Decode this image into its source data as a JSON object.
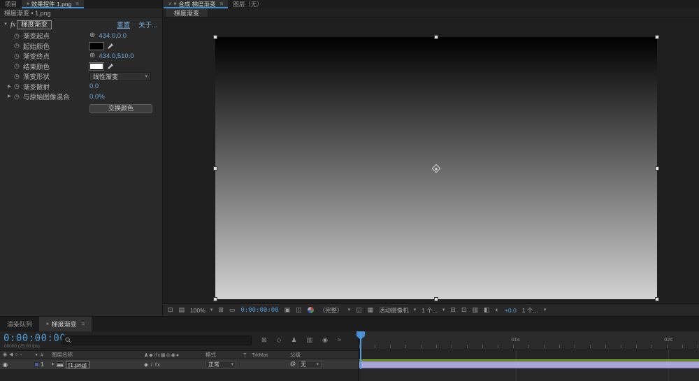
{
  "colors": {
    "accent": "#3f8fd2",
    "value_blue": "#6fa8d8",
    "timecode_blue": "#4d9bd6",
    "green_bar": "#74ab10",
    "layer_bar": "#a8a5d6",
    "label_chip": "#4f5d99",
    "canvas_top": "#000000",
    "canvas_bottom": "#d2d2d2"
  },
  "icons": {
    "panel": "■",
    "menu": "≡",
    "close": "×",
    "tri_down": "▼",
    "tri_right": "▶",
    "stopwatch": "◷",
    "crosshair": "⊕",
    "chevron": "▾",
    "screen": "⊡",
    "monitor": "▤",
    "grid_options": "⊞",
    "mask_vis": "▭",
    "snapshot": "▣",
    "show_snapshot": "◫",
    "roi": "◱",
    "transparency_grid": "▦",
    "pixel_aspect": "⊟",
    "fast_previews": "⊡",
    "ruler": "▥",
    "guides": "◧",
    "exposure": "◐",
    "flowchart": "⊠",
    "draft3d": "◇",
    "shy": "♟",
    "frame_blend": "▥",
    "motion_blur": "◉",
    "graph_editor": "≈",
    "eye": "◉",
    "audio": "◀",
    "solo": "○",
    "lock": "▫",
    "label_dot": "●",
    "hash": "#",
    "switches_header": "♟◆\\fx▦◎◉●",
    "layer_switches": "◆ / fx",
    "pickwhip": "@"
  },
  "left_panel": {
    "tabs": [
      {
        "label": "项目"
      },
      {
        "label": "效果控件 1.png"
      }
    ],
    "breadcrumb": "梯度渐变 • 1.png",
    "effect": {
      "fx": "fx",
      "name": "梯度渐变",
      "reset": "重置",
      "about": "关于...",
      "rows": [
        {
          "label": "渐变起点",
          "value": "434.0,0.0"
        },
        {
          "label": "起始颜色",
          "color": "#000000"
        },
        {
          "label": "渐变终点",
          "value": "434.0,510.0"
        },
        {
          "label": "结束颜色",
          "color": "#ffffff"
        },
        {
          "label": "渐变形状",
          "value": "线性渐变"
        },
        {
          "label": "渐变散射",
          "value": "0.0"
        },
        {
          "label": "与原始图像混合",
          "value": "0.0%"
        }
      ],
      "swap": "交换颜色"
    }
  },
  "viewer": {
    "tabs": [
      {
        "label": "合成 梯度渐变"
      },
      {
        "label": "图层（无）"
      }
    ],
    "subtab": "梯度渐变",
    "toolbar": {
      "zoom": "100%",
      "timecode": "0:00:00:00",
      "resolution": "（完整）",
      "camera": "活动摄像机",
      "views": "1 个...",
      "exposure": "+0.0",
      "renderer": "1 个…"
    }
  },
  "timeline": {
    "tabs": [
      {
        "label": "渲染队列"
      },
      {
        "label": "梯度渐变"
      }
    ],
    "timecode": "0:00:00:00",
    "fps": "00000 (25.00 fps)",
    "search_placeholder": "",
    "headers": {
      "name": "图层名称",
      "mode": "模式",
      "t": "T",
      "trkmat": "TrkMat",
      "parent": "父级"
    },
    "layer": {
      "index": "1",
      "name": "[1.png]",
      "mode": "正常",
      "parent": "无"
    },
    "ruler_labels": [
      "01s",
      "02s"
    ]
  }
}
